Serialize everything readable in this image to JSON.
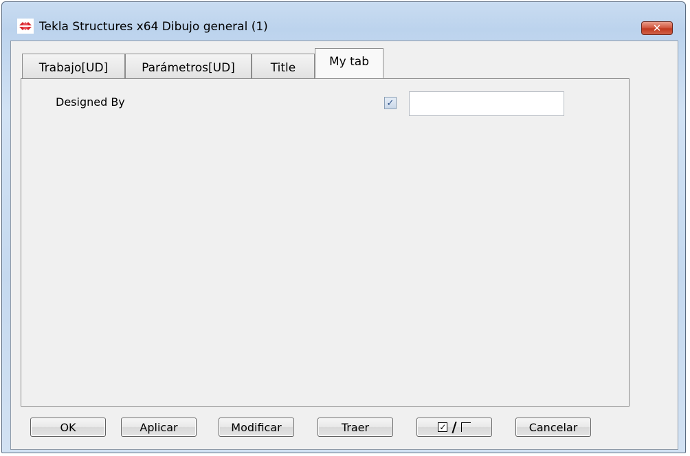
{
  "window": {
    "title": "Tekla Structures x64  Dibujo general (1)",
    "close_label": "✕"
  },
  "tabs": [
    {
      "label": "Trabajo[UD]",
      "active": false
    },
    {
      "label": "Parámetros[UD]",
      "active": false
    },
    {
      "label": "Title",
      "active": false
    },
    {
      "label": "My tab",
      "active": true
    }
  ],
  "panel": {
    "field_label": "Designed By",
    "field_enabled_checked": true,
    "field_value": ""
  },
  "buttons": {
    "ok": "OK",
    "apply": "Aplicar",
    "modify": "Modificar",
    "get": "Traer",
    "cancel": "Cancelar"
  },
  "colors": {
    "titlebar_bg": "#c9dcf1",
    "close_red": "#c1391f",
    "dialog_bg": "#f0f0f0"
  }
}
